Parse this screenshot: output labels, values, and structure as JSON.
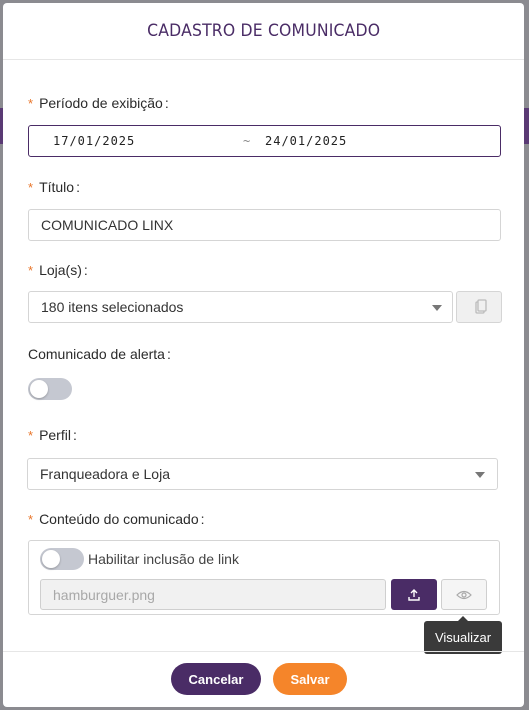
{
  "modal": {
    "title": "CADASTRO DE COMUNICADO"
  },
  "form": {
    "required_mark": "*",
    "period": {
      "label": "Período de exibição",
      "start": "17/01/2025",
      "separator": "~",
      "end": "24/01/2025"
    },
    "title": {
      "label": "Título",
      "value": "COMUNICADO LINX"
    },
    "stores": {
      "label": "Loja(s)",
      "value": "180 itens selecionados"
    },
    "alert": {
      "label": "Comunicado de alerta",
      "enabled": false
    },
    "profile": {
      "label": "Perfil",
      "value": "Franqueadora e Loja"
    },
    "content": {
      "label": "Conteúdo do comunicado",
      "link_toggle_label": "Habilitar inclusão de link",
      "link_enabled": false,
      "file_placeholder": "hamburguer.png"
    },
    "colon": ":"
  },
  "tooltip": {
    "text": "Visualizar"
  },
  "footer": {
    "cancel_label": "Cancelar",
    "save_label": "Salvar"
  },
  "colors": {
    "primary": "#4a2c66",
    "accent": "#f5852a",
    "required": "#e8752a"
  },
  "icons": {
    "upload": "upload-icon",
    "view": "eye-icon",
    "copy": "copy-icon",
    "dropdown": "chevron-down-icon"
  }
}
